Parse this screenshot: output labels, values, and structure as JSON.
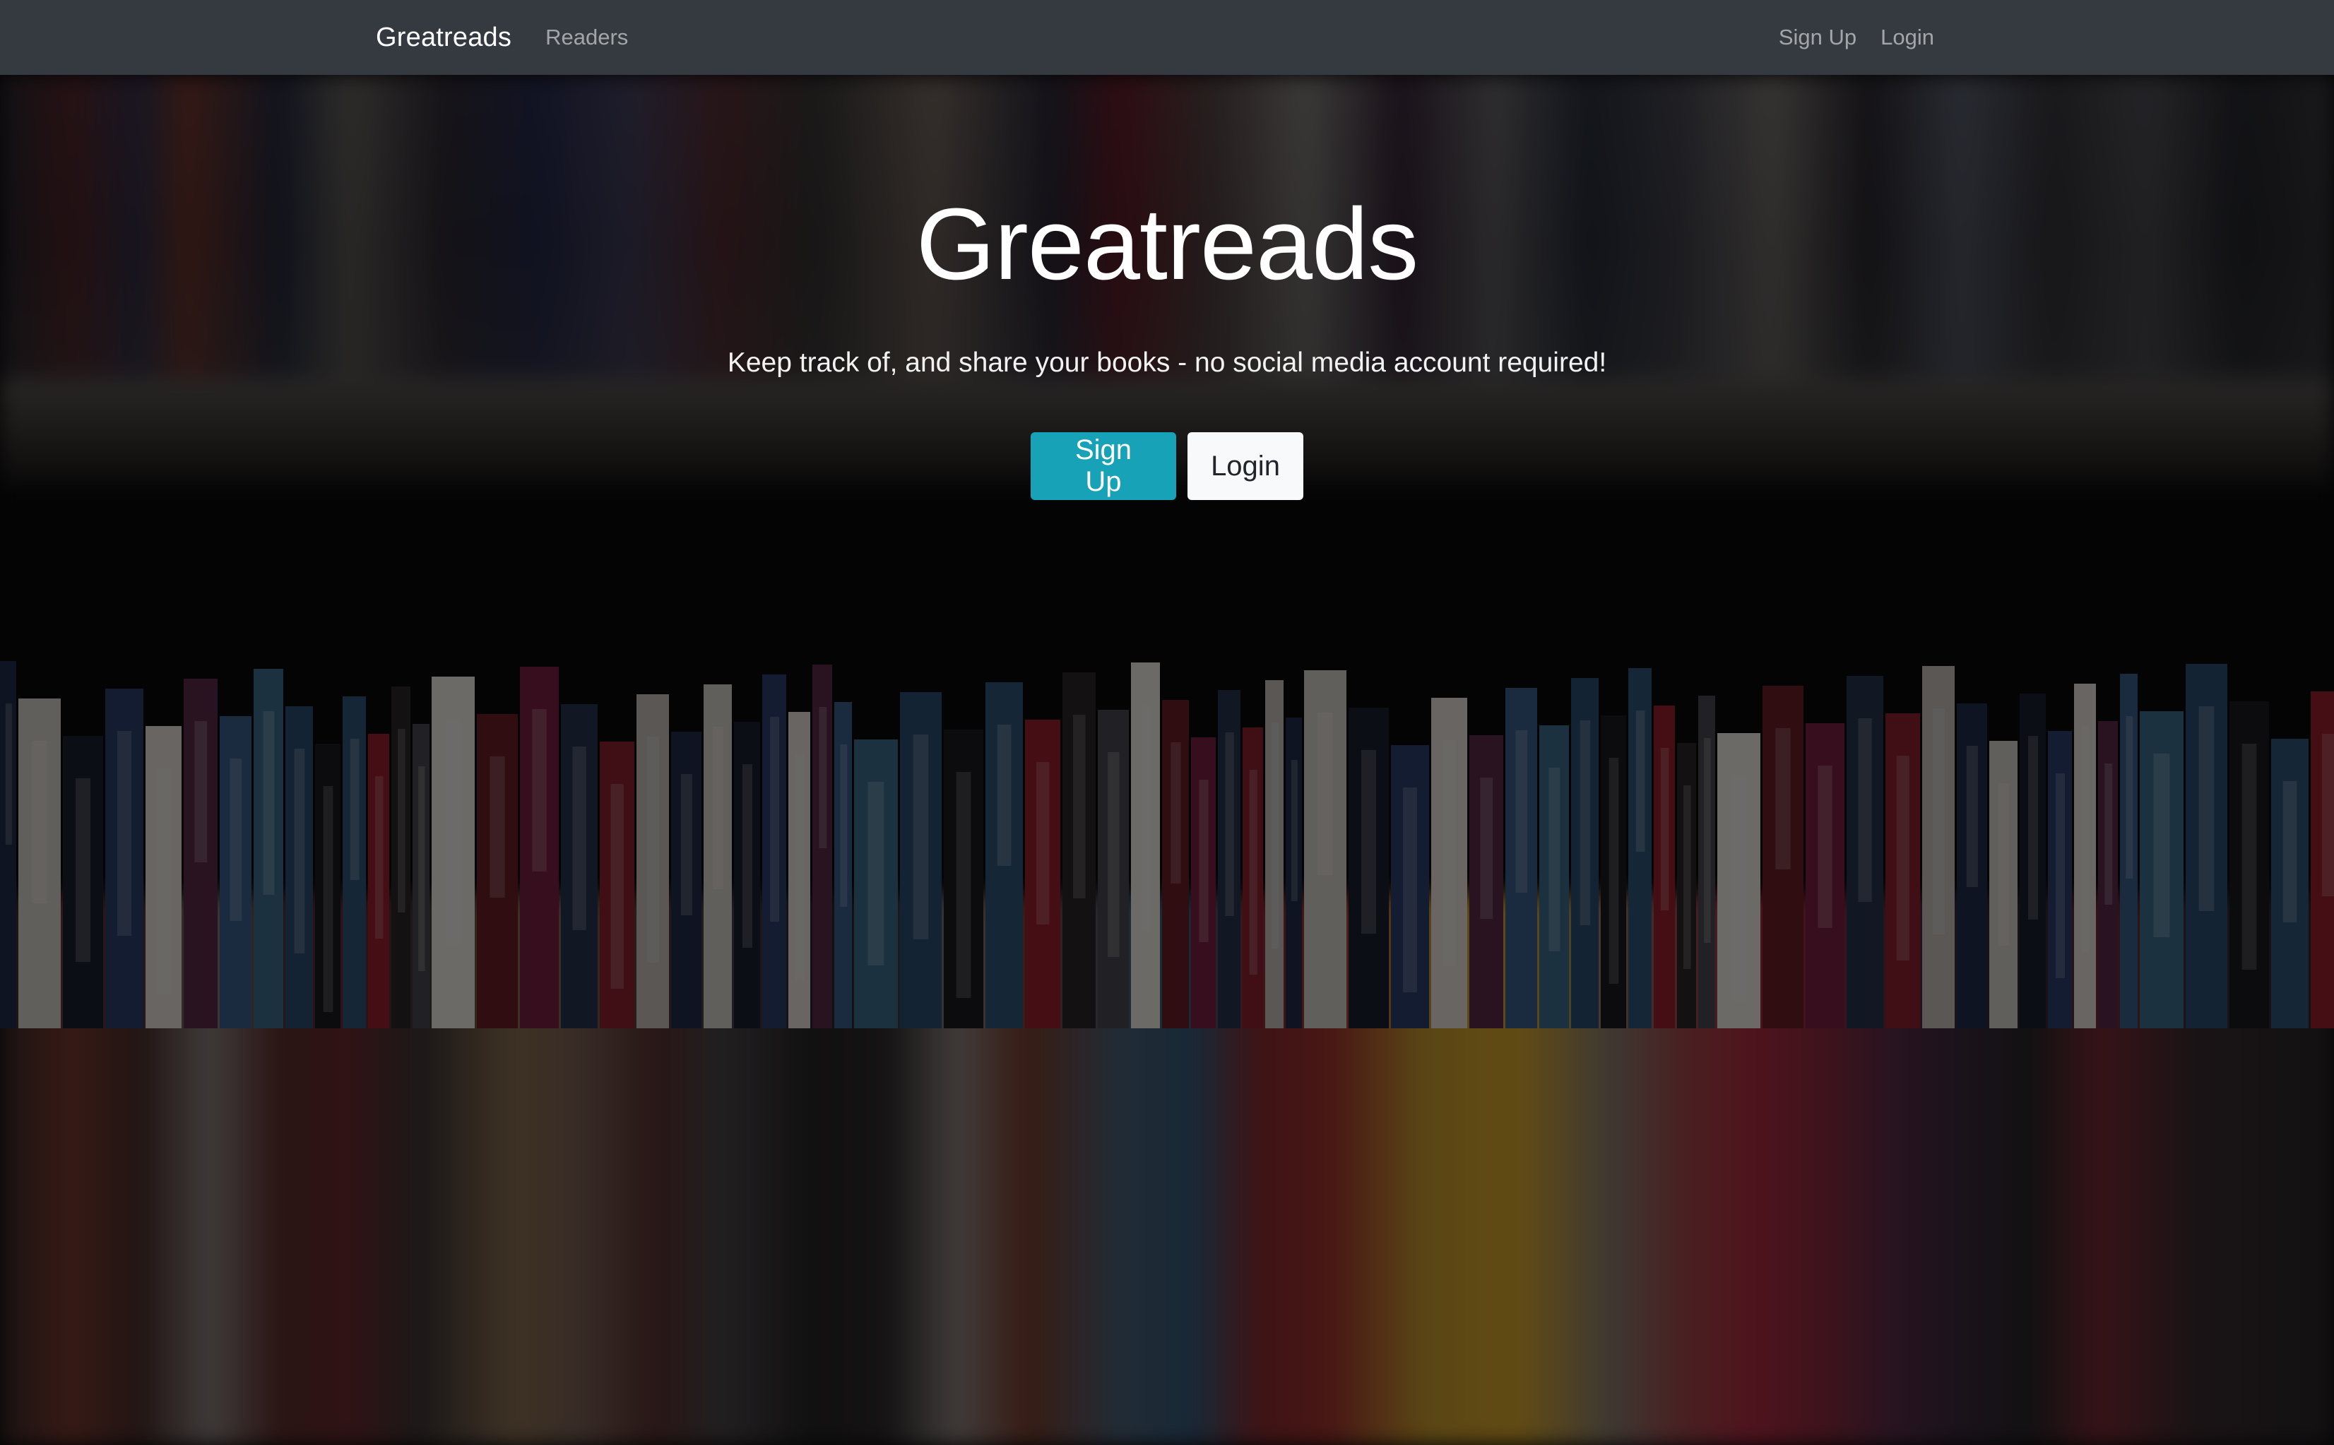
{
  "navbar": {
    "brand": "Greatreads",
    "left_links": [
      {
        "label": "Readers"
      }
    ],
    "right_links": [
      {
        "label": "Sign Up"
      },
      {
        "label": "Login"
      }
    ]
  },
  "hero": {
    "title": "Greatreads",
    "subtitle": "Keep track of, and share your books - no social media account required!",
    "signup_label": "Sign Up",
    "login_label": "Login"
  },
  "colors": {
    "navbar_bg": "#343a40",
    "signup_button": "#17a2b8",
    "login_button": "#f8f9fa"
  }
}
